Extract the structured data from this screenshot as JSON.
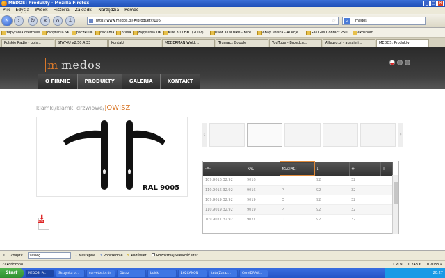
{
  "window": {
    "title": "MEDOS: Produkty - Mozilla Firefox"
  },
  "menubar": [
    "Plik",
    "Edycja",
    "Widok",
    "Historia",
    "Zakładki",
    "Narzędzia",
    "Pomoc"
  ],
  "navigation": {
    "url": "http://www.medos.pl/#/produkty/106",
    "search": "medos"
  },
  "bookmarks": [
    "zapytania ofertowe",
    "zapytania SK",
    "paczki UK",
    "reklama",
    "prasa",
    "zapytania DK",
    "KTM 300 EXC (2002) ...",
    "Used KTM Bike - Bike ...",
    "eBay Polska - Aukcje i...",
    "Gas Gas Contact 250...",
    "ekosport"
  ],
  "tabs": [
    {
      "label": "Polskie Radio - pols...",
      "active": false
    },
    {
      "label": "STAT4U v2.50.4.33",
      "active": false
    },
    {
      "label": "Kontakt",
      "active": false
    },
    {
      "label": "MEDERMAN WALL ...",
      "active": false
    },
    {
      "label": "Tłumacz Google",
      "active": false
    },
    {
      "label": "YouTube - Broadca...",
      "active": false
    },
    {
      "label": "Allegro.pl - aukcje i...",
      "active": false
    },
    {
      "label": "MEDOS: Produkty",
      "active": true
    }
  ],
  "site": {
    "logo": "medos",
    "menu": [
      "O FIRMIE",
      "PRODUKTY",
      "GALERIA",
      "KONTAKT"
    ],
    "breadcrumb": {
      "path": "klamki/klamki drzwiowe/",
      "current": "JOWISZ"
    },
    "product_label": "RAL 9005",
    "table": {
      "headers": [
        "-=-",
        "RAL",
        "KSZTAŁT",
        "L",
        "",
        ""
      ],
      "rows": [
        [
          "109.9016.32.92",
          "9016",
          "O",
          "92",
          "32"
        ],
        [
          "110.9016.32.92",
          "9016",
          "P",
          "92",
          "32"
        ],
        [
          "109.9019.32.92",
          "9019",
          "O",
          "92",
          "32"
        ],
        [
          "110.9019.32.92",
          "9019",
          "P",
          "92",
          "32"
        ],
        [
          "109.9077.32.92",
          "9077",
          "O",
          "92",
          "32"
        ]
      ]
    }
  },
  "findbar": {
    "label": "Znajdź:",
    "value": "zasięg",
    "next": "Następne",
    "prev": "Poprzednie",
    "highlight": "Podświetl",
    "match_case": "Rozróżniaj wielkość liter"
  },
  "statusbar": {
    "text": "Zakończono",
    "right": [
      "1 PLN",
      "0.248 €",
      "0.2083 £"
    ]
  },
  "taskbar": {
    "start": "Start",
    "tasks": [
      "MEDOS: Pr...",
      "Skrzynka o...",
      "corvette.kv.dr",
      "Obraz",
      "buick",
      "162CANON",
      "tata(Zaraz...",
      "CorelDRAW..."
    ],
    "clock": "20:27"
  }
}
